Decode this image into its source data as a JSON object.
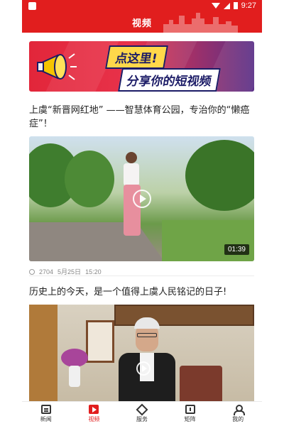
{
  "status_bar": {
    "time": "9:27",
    "icons": [
      "app-notification-icon",
      "wifi-icon",
      "signal-icon",
      "battery-icon"
    ]
  },
  "header": {
    "title": "视频",
    "accent_color": "#e11e1e"
  },
  "banner": {
    "line1": "点这里!",
    "line2": "分享你的短视频",
    "icon": "megaphone-icon"
  },
  "feed": [
    {
      "title": "上虞“新晋网红地” ——智慧体育公园，专治你的“懒癌症”！",
      "duration": "01:39",
      "views": "2704",
      "date": "5月25日",
      "time": "15:20"
    },
    {
      "title": "历史上的今天，是一个值得上虞人民铭记的日子!"
    }
  ],
  "tabbar": {
    "active_color": "#e11e1e",
    "items": [
      {
        "label": "新闻",
        "icon": "news-icon"
      },
      {
        "label": "视频",
        "icon": "video-icon",
        "active": true
      },
      {
        "label": "服务",
        "icon": "service-icon"
      },
      {
        "label": "矩阵",
        "icon": "matrix-icon"
      },
      {
        "label": "我的",
        "icon": "profile-icon"
      }
    ]
  }
}
